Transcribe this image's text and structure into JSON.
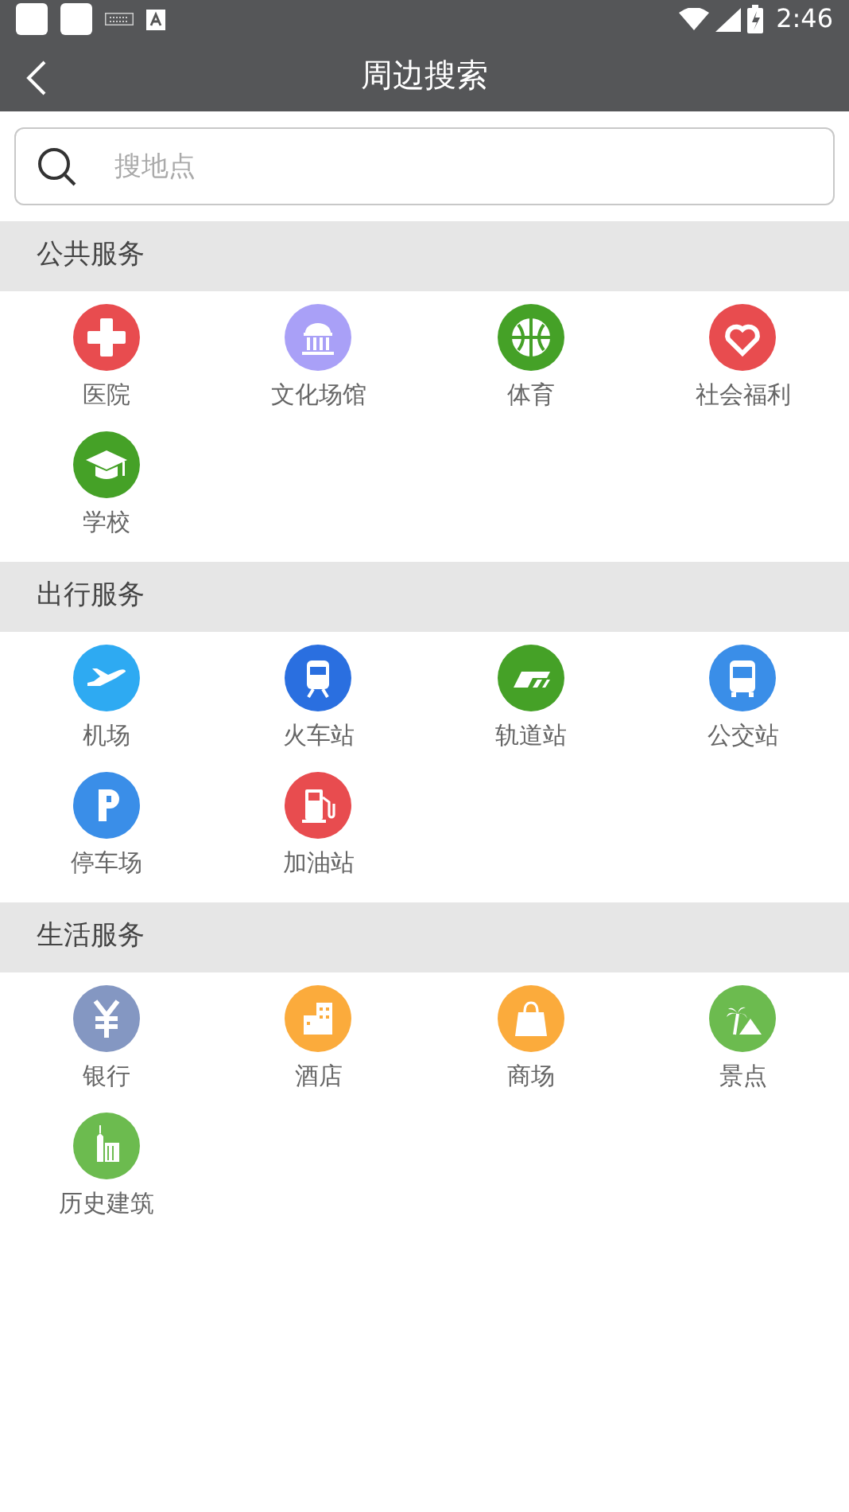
{
  "status_bar": {
    "time": "2:46"
  },
  "app_bar": {
    "title": "周边搜索"
  },
  "search": {
    "placeholder": "搜地点"
  },
  "sections": [
    {
      "title": "公共服务",
      "items": [
        {
          "label": "医院",
          "color": "#e84c4f"
        },
        {
          "label": "文化场馆",
          "color": "#a9a0f7"
        },
        {
          "label": "体育",
          "color": "#45a127"
        },
        {
          "label": "社会福利",
          "color": "#e84c4f"
        },
        {
          "label": "学校",
          "color": "#45a127"
        }
      ]
    },
    {
      "title": "出行服务",
      "items": [
        {
          "label": "机场",
          "color": "#2eaaf2"
        },
        {
          "label": "火车站",
          "color": "#2a6fe0"
        },
        {
          "label": "轨道站",
          "color": "#45a127"
        },
        {
          "label": "公交站",
          "color": "#3a8ee8"
        },
        {
          "label": "停车场",
          "color": "#3a8ee8"
        },
        {
          "label": "加油站",
          "color": "#e84c4f"
        }
      ]
    },
    {
      "title": "生活服务",
      "items": [
        {
          "label": "银行",
          "color": "#8497c2"
        },
        {
          "label": "酒店",
          "color": "#fbab3c"
        },
        {
          "label": "商场",
          "color": "#fbab3c"
        },
        {
          "label": "景点",
          "color": "#6cbb4f"
        },
        {
          "label": "历史建筑",
          "color": "#6cbb4f"
        }
      ]
    }
  ]
}
